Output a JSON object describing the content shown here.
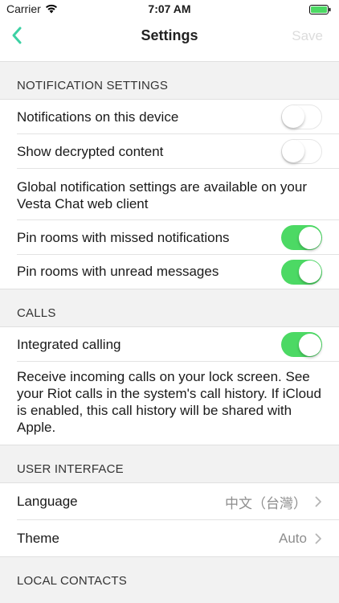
{
  "status_bar": {
    "carrier": "Carrier",
    "time": "7:07 AM"
  },
  "nav": {
    "title": "Settings",
    "save_label": "Save"
  },
  "colors": {
    "accent": "#4cd964",
    "back_arrow": "#3dd1a4",
    "save_disabled": "#dcdcdc"
  },
  "notification_settings": {
    "header": "NOTIFICATION SETTINGS",
    "notifications_device": {
      "label": "Notifications on this device",
      "on": false
    },
    "show_decrypted": {
      "label": "Show decrypted content",
      "on": false
    },
    "global_info": "Global notification settings are available on your Vesta Chat web client",
    "pin_missed": {
      "label": "Pin rooms with missed notifications",
      "on": true
    },
    "pin_unread": {
      "label": "Pin rooms with unread messages",
      "on": true
    }
  },
  "calls": {
    "header": "CALLS",
    "integrated": {
      "label": "Integrated calling",
      "on": true
    },
    "info": "Receive incoming calls on your lock screen. See your Riot calls in the system's call history. If iCloud is enabled, this call history will be shared with Apple."
  },
  "user_interface": {
    "header": "USER INTERFACE",
    "language": {
      "label": "Language",
      "value": "中文（台灣）"
    },
    "theme": {
      "label": "Theme",
      "value": "Auto"
    }
  },
  "local_contacts": {
    "header": "LOCAL CONTACTS"
  }
}
